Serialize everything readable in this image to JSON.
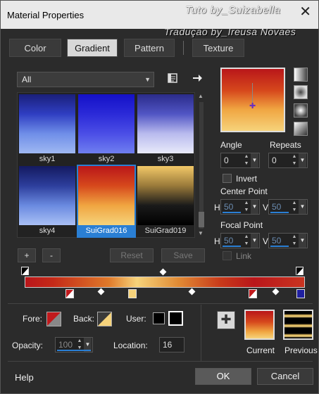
{
  "window": {
    "title": "Material Properties",
    "close": "✕"
  },
  "watermark": {
    "line1": "Tuto by_Suizabella",
    "line2": "Tradução by_Ireusa Novaes"
  },
  "tabs": [
    {
      "label": "Color"
    },
    {
      "label": "Gradient"
    },
    {
      "label": "Pattern"
    },
    {
      "label": "Texture"
    }
  ],
  "library": {
    "category": "All",
    "items": [
      {
        "label": "sky1",
        "colors": [
          "#1a1f7a",
          "#2f3ec2",
          "#6f8ee8",
          "#9fb8f2"
        ]
      },
      {
        "label": "sky2",
        "colors": [
          "#1410c8",
          "#2b2ad8",
          "#4b4ee6",
          "#6f7ff0"
        ]
      },
      {
        "label": "sky3",
        "colors": [
          "#2a2b8a",
          "#5155c4",
          "#b9bbee",
          "#e8eafa"
        ]
      },
      {
        "label": "sky4",
        "colors": [
          "#141a60",
          "#2d3e9c",
          "#6a8ae0",
          "#a9c0f5"
        ]
      },
      {
        "label": "SuiGrad016",
        "colors": [
          "#b9161a",
          "#d6481c",
          "#f0a541",
          "#f6d37b"
        ]
      },
      {
        "label": "SuiGrad019",
        "colors": [
          "#f2c868",
          "#9a7a3a",
          "#1a1a1a",
          "#000000"
        ]
      }
    ],
    "selected": "SuiGrad016"
  },
  "buttons": {
    "add": "+",
    "remove": "-",
    "reset": "Reset",
    "save": "Save"
  },
  "angle": {
    "label": "Angle",
    "value": "0"
  },
  "repeats": {
    "label": "Repeats",
    "value": "0"
  },
  "invert": {
    "label": "Invert"
  },
  "center_point": {
    "label": "Center Point",
    "h_label": "H",
    "h": "50",
    "v_label": "V",
    "v": "50"
  },
  "focal_point": {
    "label": "Focal Point",
    "h_label": "H",
    "h": "50",
    "v_label": "V",
    "v": "50"
  },
  "link": {
    "label": "Link"
  },
  "fore": {
    "label": "Fore:"
  },
  "back": {
    "label": "Back:"
  },
  "user": {
    "label": "User:"
  },
  "opacity": {
    "label": "Opacity:",
    "value": "100"
  },
  "location": {
    "label": "Location:",
    "value": "16"
  },
  "current": {
    "label": "Current"
  },
  "previous": {
    "label": "Previous"
  },
  "footer": {
    "help": "Help",
    "ok": "OK",
    "cancel": "Cancel"
  },
  "colors": {
    "accent": "#2a7fd4",
    "grad_red": "#b9161a",
    "grad_gold": "#f6d37b"
  }
}
